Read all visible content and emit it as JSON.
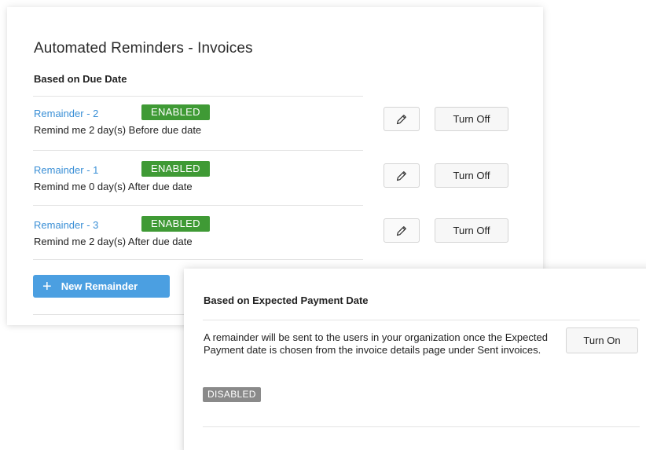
{
  "main": {
    "title": "Automated Reminders - Invoices",
    "section_label": "Based on Due Date",
    "reminders": [
      {
        "name": "Remainder - 2",
        "status": "ENABLED",
        "description": "Remind me 2 day(s) Before due date",
        "action_label": "Turn Off"
      },
      {
        "name": "Remainder - 1",
        "status": "ENABLED",
        "description": "Remind me 0 day(s) After due date",
        "action_label": "Turn Off"
      },
      {
        "name": "Remainder - 3",
        "status": "ENABLED",
        "description": "Remind me 2 day(s) After due date",
        "action_label": "Turn Off"
      }
    ],
    "new_button_label": "New Remainder",
    "new_button_icon": "plus-icon",
    "edit_icon": "pencil-icon"
  },
  "overlay": {
    "section_label": "Based on Expected Payment Date",
    "description": "A remainder will be sent to the users in your organization once the Expected Payment date is chosen from the invoice details page under Sent invoices.",
    "action_label": "Turn On",
    "status": "DISABLED"
  },
  "colors": {
    "link": "#3a8fd6",
    "enabled_badge": "#3f9a35",
    "disabled_badge": "#8a8a8a",
    "primary_button": "#4b9fe1"
  }
}
